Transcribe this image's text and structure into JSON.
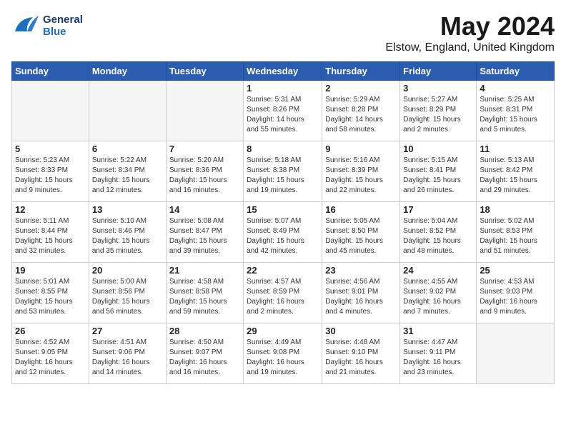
{
  "header": {
    "logo_line1": "General",
    "logo_line2": "Blue",
    "month": "May 2024",
    "location": "Elstow, England, United Kingdom"
  },
  "weekdays": [
    "Sunday",
    "Monday",
    "Tuesday",
    "Wednesday",
    "Thursday",
    "Friday",
    "Saturday"
  ],
  "weeks": [
    [
      {
        "day": "",
        "info": ""
      },
      {
        "day": "",
        "info": ""
      },
      {
        "day": "",
        "info": ""
      },
      {
        "day": "1",
        "info": "Sunrise: 5:31 AM\nSunset: 8:26 PM\nDaylight: 14 hours\nand 55 minutes."
      },
      {
        "day": "2",
        "info": "Sunrise: 5:29 AM\nSunset: 8:28 PM\nDaylight: 14 hours\nand 58 minutes."
      },
      {
        "day": "3",
        "info": "Sunrise: 5:27 AM\nSunset: 8:29 PM\nDaylight: 15 hours\nand 2 minutes."
      },
      {
        "day": "4",
        "info": "Sunrise: 5:25 AM\nSunset: 8:31 PM\nDaylight: 15 hours\nand 5 minutes."
      }
    ],
    [
      {
        "day": "5",
        "info": "Sunrise: 5:23 AM\nSunset: 8:33 PM\nDaylight: 15 hours\nand 9 minutes."
      },
      {
        "day": "6",
        "info": "Sunrise: 5:22 AM\nSunset: 8:34 PM\nDaylight: 15 hours\nand 12 minutes."
      },
      {
        "day": "7",
        "info": "Sunrise: 5:20 AM\nSunset: 8:36 PM\nDaylight: 15 hours\nand 16 minutes."
      },
      {
        "day": "8",
        "info": "Sunrise: 5:18 AM\nSunset: 8:38 PM\nDaylight: 15 hours\nand 19 minutes."
      },
      {
        "day": "9",
        "info": "Sunrise: 5:16 AM\nSunset: 8:39 PM\nDaylight: 15 hours\nand 22 minutes."
      },
      {
        "day": "10",
        "info": "Sunrise: 5:15 AM\nSunset: 8:41 PM\nDaylight: 15 hours\nand 26 minutes."
      },
      {
        "day": "11",
        "info": "Sunrise: 5:13 AM\nSunset: 8:42 PM\nDaylight: 15 hours\nand 29 minutes."
      }
    ],
    [
      {
        "day": "12",
        "info": "Sunrise: 5:11 AM\nSunset: 8:44 PM\nDaylight: 15 hours\nand 32 minutes."
      },
      {
        "day": "13",
        "info": "Sunrise: 5:10 AM\nSunset: 8:46 PM\nDaylight: 15 hours\nand 35 minutes."
      },
      {
        "day": "14",
        "info": "Sunrise: 5:08 AM\nSunset: 8:47 PM\nDaylight: 15 hours\nand 39 minutes."
      },
      {
        "day": "15",
        "info": "Sunrise: 5:07 AM\nSunset: 8:49 PM\nDaylight: 15 hours\nand 42 minutes."
      },
      {
        "day": "16",
        "info": "Sunrise: 5:05 AM\nSunset: 8:50 PM\nDaylight: 15 hours\nand 45 minutes."
      },
      {
        "day": "17",
        "info": "Sunrise: 5:04 AM\nSunset: 8:52 PM\nDaylight: 15 hours\nand 48 minutes."
      },
      {
        "day": "18",
        "info": "Sunrise: 5:02 AM\nSunset: 8:53 PM\nDaylight: 15 hours\nand 51 minutes."
      }
    ],
    [
      {
        "day": "19",
        "info": "Sunrise: 5:01 AM\nSunset: 8:55 PM\nDaylight: 15 hours\nand 53 minutes."
      },
      {
        "day": "20",
        "info": "Sunrise: 5:00 AM\nSunset: 8:56 PM\nDaylight: 15 hours\nand 56 minutes."
      },
      {
        "day": "21",
        "info": "Sunrise: 4:58 AM\nSunset: 8:58 PM\nDaylight: 15 hours\nand 59 minutes."
      },
      {
        "day": "22",
        "info": "Sunrise: 4:57 AM\nSunset: 8:59 PM\nDaylight: 16 hours\nand 2 minutes."
      },
      {
        "day": "23",
        "info": "Sunrise: 4:56 AM\nSunset: 9:01 PM\nDaylight: 16 hours\nand 4 minutes."
      },
      {
        "day": "24",
        "info": "Sunrise: 4:55 AM\nSunset: 9:02 PM\nDaylight: 16 hours\nand 7 minutes."
      },
      {
        "day": "25",
        "info": "Sunrise: 4:53 AM\nSunset: 9:03 PM\nDaylight: 16 hours\nand 9 minutes."
      }
    ],
    [
      {
        "day": "26",
        "info": "Sunrise: 4:52 AM\nSunset: 9:05 PM\nDaylight: 16 hours\nand 12 minutes."
      },
      {
        "day": "27",
        "info": "Sunrise: 4:51 AM\nSunset: 9:06 PM\nDaylight: 16 hours\nand 14 minutes."
      },
      {
        "day": "28",
        "info": "Sunrise: 4:50 AM\nSunset: 9:07 PM\nDaylight: 16 hours\nand 16 minutes."
      },
      {
        "day": "29",
        "info": "Sunrise: 4:49 AM\nSunset: 9:08 PM\nDaylight: 16 hours\nand 19 minutes."
      },
      {
        "day": "30",
        "info": "Sunrise: 4:48 AM\nSunset: 9:10 PM\nDaylight: 16 hours\nand 21 minutes."
      },
      {
        "day": "31",
        "info": "Sunrise: 4:47 AM\nSunset: 9:11 PM\nDaylight: 16 hours\nand 23 minutes."
      },
      {
        "day": "",
        "info": ""
      }
    ]
  ]
}
